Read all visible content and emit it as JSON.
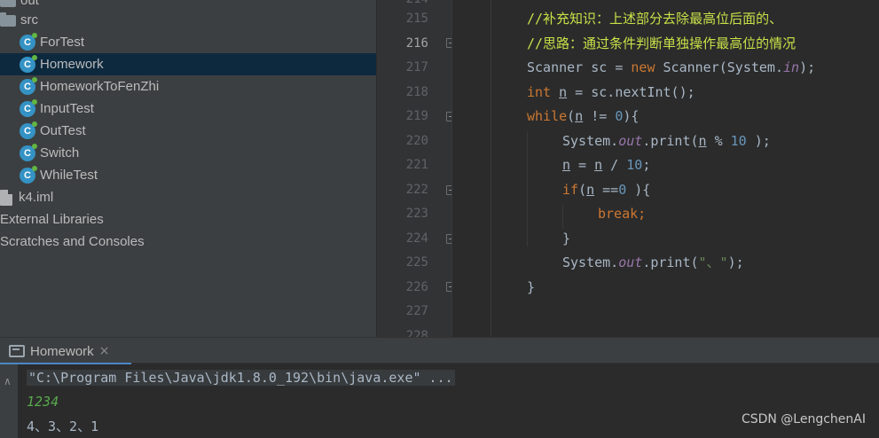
{
  "project_tree": {
    "items": [
      {
        "label": "out",
        "icon": "folder-icon"
      },
      {
        "label": "src",
        "icon": "folder-icon"
      },
      {
        "label": "ForTest",
        "icon": "java-class-icon"
      },
      {
        "label": "Homework",
        "icon": "java-class-icon"
      },
      {
        "label": "HomeworkToFenZhi",
        "icon": "java-class-icon"
      },
      {
        "label": "InputTest",
        "icon": "java-class-icon"
      },
      {
        "label": "OutTest",
        "icon": "java-class-icon"
      },
      {
        "label": "Switch",
        "icon": "java-class-icon"
      },
      {
        "label": "WhileTest",
        "icon": "java-class-icon"
      },
      {
        "label": "k4.iml",
        "icon": "iml-file-icon"
      },
      {
        "label": "External Libraries",
        "icon": ""
      },
      {
        "label": "Scratches and Consoles",
        "icon": ""
      }
    ],
    "selected": "Homework"
  },
  "editor": {
    "current_line": "216",
    "line_numbers": [
      "215",
      "216",
      "217",
      "218",
      "219",
      "220",
      "221",
      "222",
      "223",
      "224",
      "225",
      "226",
      "227"
    ],
    "code": {
      "l215_comment": "//补充知识：上述部分去除最高位后面的、",
      "l216_comment": "//思路：通过条件判断单独操作最高位的情况",
      "l217_t1": "Scanner sc = ",
      "l217_new": "new",
      "l217_t2": " Scanner(System.",
      "l217_in": "in",
      "l217_t3": ");",
      "l218_int": "int",
      "l218_sp": " ",
      "l218_n": "n",
      "l218_t": " = sc.nextInt();",
      "l219_while": "while",
      "l219_p": "(",
      "l219_n": "n",
      "l219_t": " != ",
      "l219_zero": "0",
      "l219_end": "){",
      "l220_t1": "System.",
      "l220_out": "out",
      "l220_t2": ".print(",
      "l220_n": "n",
      "l220_t3": " % ",
      "l220_ten": "10",
      "l220_t4": " );",
      "l221_n1": "n",
      "l221_t1": " = ",
      "l221_n2": "n",
      "l221_t2": " / ",
      "l221_ten": "10",
      "l221_t3": ";",
      "l222_if": "if",
      "l222_p": "(",
      "l222_n": "n",
      "l222_t": " ==",
      "l222_zero": "0",
      "l222_end": " ){",
      "l223_break": "break",
      "l223_semi": ";",
      "l224": "}",
      "l225_t1": "System.",
      "l225_out": "out",
      "l225_t2": ".print(",
      "l225_str": "\"、\"",
      "l225_t3": ");",
      "l226": "}"
    }
  },
  "run_panel": {
    "tab_label": "Homework",
    "close_glyph": "×",
    "console": {
      "command": "\"C:\\Program Files\\Java\\jdk1.8.0_192\\bin\\java.exe\" ...",
      "user_input": "1234",
      "output": "4、3、2、1"
    }
  },
  "watermark": "CSDN @LengchenAI"
}
